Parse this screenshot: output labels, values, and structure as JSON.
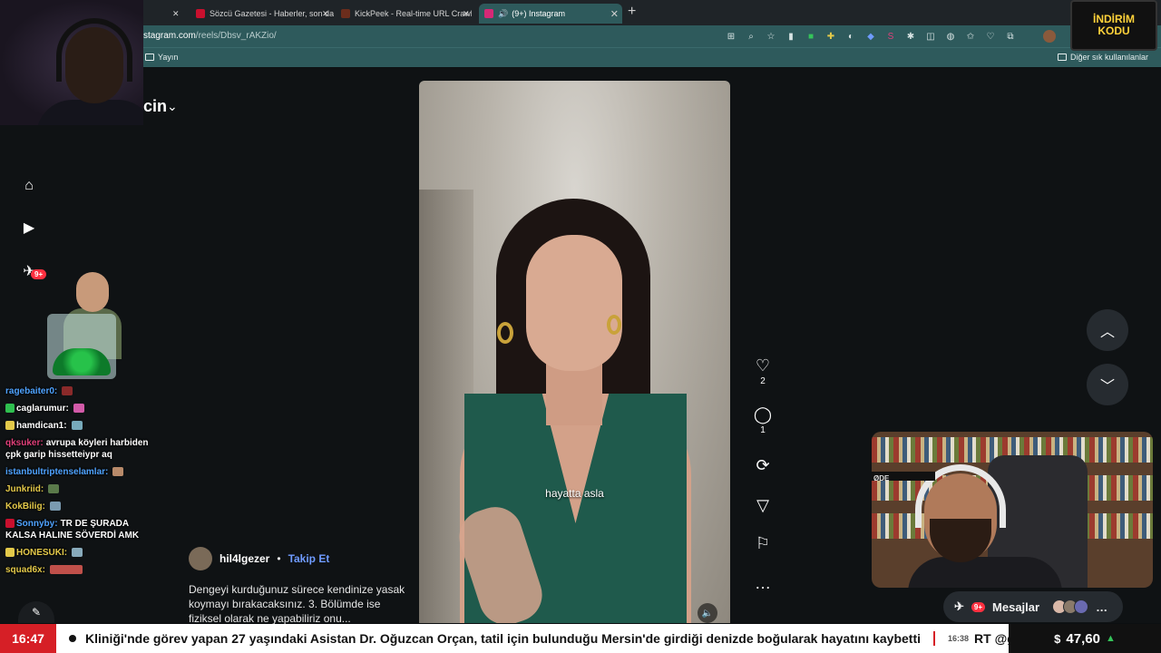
{
  "browser": {
    "tabs": [
      {
        "title": "Sözcü Gazetesi - Haberler, son da",
        "favicon_color": "#c8102e",
        "active": false
      },
      {
        "title": "KickPeek - Real-time URL Crawler",
        "favicon_color": "#6b2d1c",
        "active": false
      },
      {
        "title": "(9+) Instagram",
        "favicon_color": "#d62976",
        "active": true
      }
    ],
    "url_host": "stagram.com",
    "url_path": "/reels/Dbsv_rAKZio/",
    "bookmark_yayin": "Yayın",
    "bookmark_other": "Diğer sık kullanılanlar"
  },
  "instagram": {
    "header_title": "cin",
    "nav_badge": "9+",
    "reel": {
      "caption_overlay": "hayatta asla",
      "author": "hil4lgezer",
      "separator": "•",
      "follow_label": "Takip Et",
      "description": "Dengeyi kurduğunuz sürece kendinize yasak koymayı bırakacaksınız. 3. Bölümde ise fiziksel olarak ne yapabiliriz onu...",
      "likes": "2",
      "comments": "1"
    },
    "messages_label": "Mesajlar",
    "messages_badge": "9+"
  },
  "stream": {
    "promo_line1": "İNDİRİM",
    "promo_line2": "KODU",
    "mic_label": "ØDE",
    "chat": [
      {
        "user": "ragebaiter0:",
        "user_color": "#4fa3ff",
        "text": "",
        "badge": null,
        "emote": "#8a2a2a"
      },
      {
        "user": "caglarumur:",
        "user_color": "#ffffff",
        "text": "",
        "badge": "#2fbf4f",
        "emote": "#d25aa8"
      },
      {
        "user": "hamdican1:",
        "user_color": "#ffffff",
        "text": "",
        "badge": "#e3c94a",
        "emote": "#7ab"
      },
      {
        "user": "qksuker:",
        "user_color": "#e0407a",
        "text": "avrupa köyleri harbiden çpk garip hissetteiypr aq",
        "badge": null,
        "emote": null
      },
      {
        "user": "istanbultriptenselamlar:",
        "user_color": "#4fa3ff",
        "text": "",
        "badge": null,
        "emote": "#b88a6a"
      },
      {
        "user": "Junkriid:",
        "user_color": "#e3c94a",
        "text": "",
        "badge": null,
        "emote": "#5a7a4a"
      },
      {
        "user": "KokBilig:",
        "user_color": "#e3c94a",
        "text": "",
        "badge": null,
        "emote": "#7a9ab0"
      },
      {
        "user": "Sonnyby:",
        "user_color": "#4fa3ff",
        "text": "TR DE ŞURADA KALSA HALINE SÖVERDİ AMK",
        "badge": "#c8102e",
        "emote": null
      },
      {
        "user": "HONESUKI:",
        "user_color": "#e3c94a",
        "text": "",
        "badge": "#e3c94a",
        "emote": "#8ab"
      },
      {
        "user": "squad6x:",
        "user_color": "#e3c94a",
        "text": "",
        "badge": null,
        "emote_wide": "#c0504a"
      }
    ]
  },
  "ticker": {
    "time": "16:47",
    "headline": "Kliniği'nde görev yapan 27 yaşındaki Asistan Dr. Oğuzcan Orçan, tatil için bulunduğu Mersin'de girdiği denizde boğularak hayatını kaybetti",
    "next_time": "16:38",
    "next_source": "RT @g",
    "currency_symbol": "$",
    "currency_value": "47,60",
    "currency_trend": "▲"
  },
  "colors": {
    "chrome": "#2e5a5c",
    "accent_red": "#d61f26",
    "ig_blue": "#6f9bff"
  }
}
